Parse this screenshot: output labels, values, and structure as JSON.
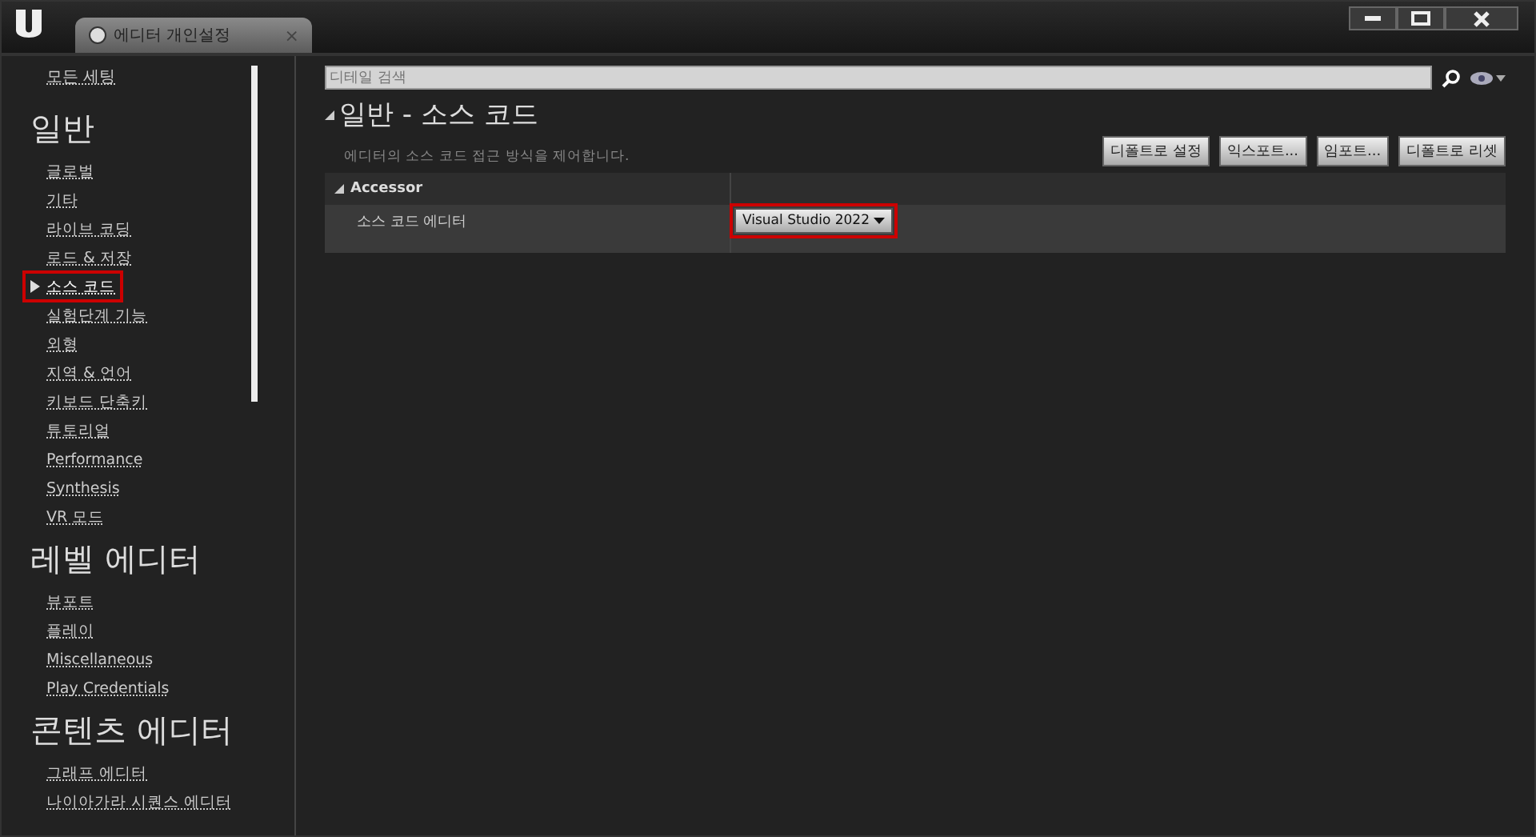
{
  "window": {
    "tab_title": "에디터 개인설정",
    "close_symbol": "×"
  },
  "sidebar": {
    "all_settings": "모든 세팅",
    "sections": [
      {
        "title": "일반",
        "items": [
          {
            "label": "글로벌",
            "selected": false,
            "highlighted": false
          },
          {
            "label": "기타",
            "selected": false,
            "highlighted": false
          },
          {
            "label": "라이브 코딩",
            "selected": false,
            "highlighted": false
          },
          {
            "label": "로드 & 저장",
            "selected": false,
            "highlighted": false
          },
          {
            "label": "소스 코드",
            "selected": true,
            "highlighted": true
          },
          {
            "label": "실험단계 기능",
            "selected": false,
            "highlighted": false
          },
          {
            "label": "외형",
            "selected": false,
            "highlighted": false
          },
          {
            "label": "지역 & 언어",
            "selected": false,
            "highlighted": false
          },
          {
            "label": "키보드 단축키",
            "selected": false,
            "highlighted": false
          },
          {
            "label": "튜토리얼",
            "selected": false,
            "highlighted": false
          },
          {
            "label": "Performance",
            "selected": false,
            "highlighted": false
          },
          {
            "label": "Synthesis",
            "selected": false,
            "highlighted": false
          },
          {
            "label": "VR 모드",
            "selected": false,
            "highlighted": false
          }
        ]
      },
      {
        "title": "레벨 에디터",
        "items": [
          {
            "label": "뷰포트",
            "selected": false,
            "highlighted": false
          },
          {
            "label": "플레이",
            "selected": false,
            "highlighted": false
          },
          {
            "label": "Miscellaneous",
            "selected": false,
            "highlighted": false
          },
          {
            "label": "Play Credentials",
            "selected": false,
            "highlighted": false
          }
        ]
      },
      {
        "title": "콘텐츠 에디터",
        "items": [
          {
            "label": "그래프 에디터",
            "selected": false,
            "highlighted": false
          },
          {
            "label": "나이아가라 시퀀스 에디터",
            "selected": false,
            "highlighted": false
          }
        ]
      }
    ]
  },
  "search": {
    "placeholder": "디테일 검색"
  },
  "page": {
    "title": "일반 - 소스 코드",
    "description": "에디터의 소스 코드 접근 방식을 제어합니다.",
    "buttons": [
      "디폴트로 설정",
      "익스포트...",
      "임포트...",
      "디폴트로 리셋"
    ]
  },
  "category": {
    "title": "Accessor",
    "expanded": true,
    "rows": [
      {
        "label": "소스 코드 에디터",
        "value": "Visual Studio 2022",
        "highlighted": true
      }
    ]
  }
}
